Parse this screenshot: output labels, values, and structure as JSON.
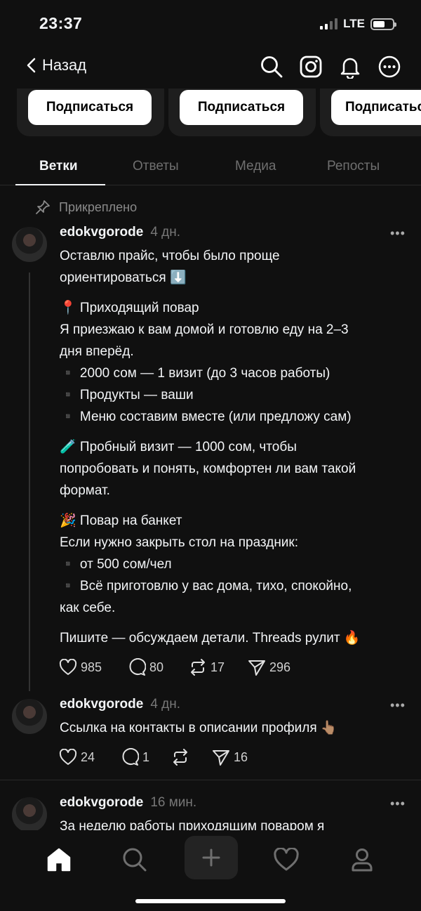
{
  "status": {
    "time": "23:37",
    "network": "LTE"
  },
  "nav": {
    "back_label": "Назад"
  },
  "follow_cards": [
    {
      "button": "Подписаться"
    },
    {
      "button": "Подписаться"
    },
    {
      "button": "Подписаться"
    }
  ],
  "tabs": [
    "Ветки",
    "Ответы",
    "Медиа",
    "Репосты"
  ],
  "pinned_label": "Прикреплено",
  "posts": [
    {
      "username": "edokvgorode",
      "time": "4 дн.",
      "lines": [
        "Оставлю прайс, чтобы было проще",
        "ориентироваться ⬇️",
        "",
        "📍 Приходящий повар",
        "Я приезжаю к вам домой и готовлю еду на 2–3",
        "дня вперёд.",
        "▪️ 2000 сом — 1 визит (до 3 часов работы)",
        "▪️ Продукты — ваши",
        "▪️ Меню составим вместе (или предложу сам)",
        "",
        "🧪 Пробный визит — 1000 сом, чтобы",
        "попробовать и понять, комфортен ли вам такой",
        "формат.",
        "",
        "🎉 Повар на банкет",
        "Если нужно закрыть стол на праздник:",
        "▪️ от 500 сом/чел",
        "▪️ Всё приготовлю у вас дома, тихо, спокойно,",
        "как себе.",
        "",
        "Пишите — обсуждаем детали. Threads рулит 🔥"
      ],
      "likes": "985",
      "replies": "80",
      "reposts": "17",
      "shares": "296"
    },
    {
      "username": "edokvgorode",
      "time": "4 дн.",
      "lines": [
        "Ссылка на контакты в описании профиля 👆🏽"
      ],
      "likes": "24",
      "replies": "1",
      "reposts": "",
      "shares": "16"
    },
    {
      "username": "edokvgorode",
      "time": "16 мин.",
      "lines": [
        "За неделю работы приходящим поваром я"
      ]
    }
  ]
}
